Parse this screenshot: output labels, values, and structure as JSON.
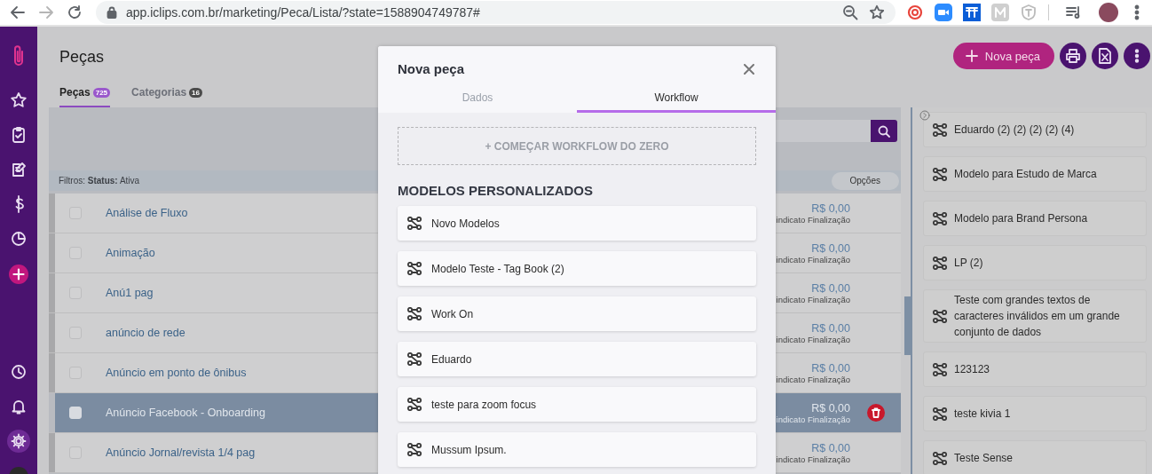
{
  "browser": {
    "url": "app.iclips.com.br/marketing/Peca/Lista/?state=1588904749787#"
  },
  "sidebar": {
    "top_items": [
      {
        "kind": "star",
        "selected": false
      },
      {
        "kind": "tasks",
        "selected": false
      },
      {
        "kind": "edit",
        "selected": false
      },
      {
        "kind": "money",
        "selected": false
      },
      {
        "kind": "chart",
        "selected": false
      },
      {
        "kind": "add",
        "selected": false
      }
    ],
    "bottom_items": [
      {
        "kind": "clock",
        "selected": false
      },
      {
        "kind": "bell",
        "selected": false
      },
      {
        "kind": "settings",
        "selected": true
      }
    ]
  },
  "header": {
    "title": "Peças",
    "tabs": [
      {
        "label": "Peças",
        "count": "725",
        "selected": true
      },
      {
        "label": "Categorias",
        "count": "16",
        "selected": false
      }
    ],
    "new_button": "Nova peça"
  },
  "list": {
    "filter": "Filtros: **Status:** Ativa",
    "options_button": "Opções",
    "rows": [
      {
        "name": "Análise de Fluxo",
        "price": "R$ 0,00",
        "status": "indicato Finalização",
        "checked": false,
        "selected": false
      },
      {
        "name": "Animação",
        "price": "R$ 0,00",
        "status": "indicato Finalização",
        "checked": false,
        "selected": false
      },
      {
        "name": "Anú1 pag",
        "price": "R$ 0,00",
        "status": "indicato Finalização",
        "checked": false,
        "selected": false
      },
      {
        "name": "anúncio de rede",
        "price": "R$ 0,00",
        "status": "indicato Finalização",
        "checked": false,
        "selected": false
      },
      {
        "name": "Anúncio em ponto de ônibus",
        "price": "R$ 0,00",
        "status": "indicato Finalização",
        "checked": false,
        "selected": false
      },
      {
        "name": "Anúncio Facebook - Onboarding",
        "price": "R$ 0,00",
        "status": "indicato Finalização",
        "checked": false,
        "selected": true
      },
      {
        "name": "Anúncio Jornal/revista 1/4 pag",
        "price": "R$ 0,00",
        "status": "indicato Finalização",
        "checked": false,
        "selected": false
      }
    ]
  },
  "templates_panel": {
    "items": [
      "Eduardo (2) (2) (2) (2) (4)",
      "Modelo para Estudo de Marca",
      "Modelo para Brand Persona",
      "LP (2)",
      "Teste com grandes textos de caracteres inválidos em um grande conjunto de dados",
      "123123",
      "teste kivia 1",
      "Teste Sense"
    ]
  },
  "modal": {
    "title": "Nova peça",
    "tabs": [
      {
        "label": "Dados",
        "selected": false
      },
      {
        "label": "Workflow",
        "selected": true
      }
    ],
    "start_button": "+ COMEÇAR WORKFLOW DO ZERO",
    "section_title": "MODELOS PERSONALIZADOS",
    "models": [
      "Novo Modelos",
      "Modelo Teste - Tag Book (2)",
      "Work On",
      "Eduardo",
      "teste para zoom focus",
      "Mussum Ipsum."
    ]
  }
}
